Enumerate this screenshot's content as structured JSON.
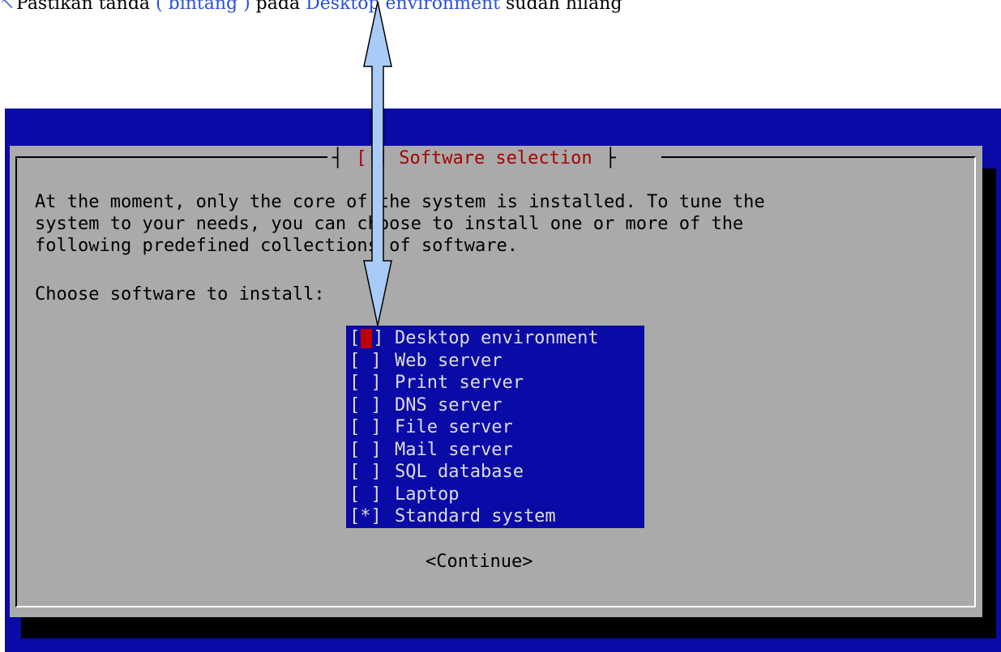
{
  "caption": {
    "prefix": "Pastikan tanda ",
    "star": "( bintang )",
    "middle": " pada ",
    "target": "Desktop environment",
    "suffix": " sudah hilang"
  },
  "dialog": {
    "title": "[!] Software selection",
    "body_lines": [
      "At the moment, only the core of the system is installed. To tune the",
      "system to your needs, you can choose to install one or more of the",
      "following predefined collections of software."
    ],
    "prompt": "Choose software to install:",
    "items": [
      {
        "mark": "[ ]",
        "label": "Desktop environment",
        "checked": false,
        "focused": true
      },
      {
        "mark": "[ ]",
        "label": "Web server",
        "checked": false
      },
      {
        "mark": "[ ]",
        "label": "Print server",
        "checked": false
      },
      {
        "mark": "[ ]",
        "label": "DNS server",
        "checked": false
      },
      {
        "mark": "[ ]",
        "label": "File server",
        "checked": false
      },
      {
        "mark": "[ ]",
        "label": "Mail server",
        "checked": false
      },
      {
        "mark": "[ ]",
        "label": "SQL database",
        "checked": false
      },
      {
        "mark": "[ ]",
        "label": "Laptop",
        "checked": false
      },
      {
        "mark": "[*]",
        "label": "Standard system",
        "checked": true
      }
    ],
    "continue_label": "<Continue>"
  },
  "colors": {
    "screen_bg": "#0a0aa6",
    "dialog_bg": "#aaaaaa",
    "title_red": "#a80000",
    "cursor_red": "#c00000",
    "arrow_fill": "#a8ccf5",
    "caption_highlight": "#2a50d8"
  },
  "icons": {
    "caption_marker": "note-icon",
    "annotation": "double-arrow-icon"
  }
}
